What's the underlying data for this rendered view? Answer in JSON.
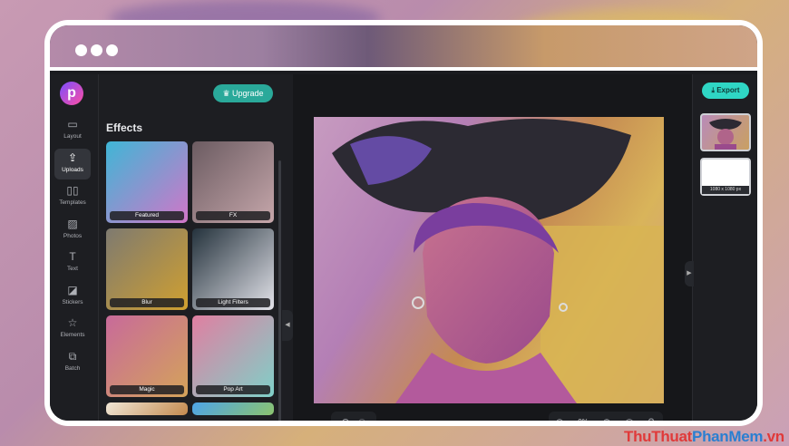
{
  "header": {
    "upgrade_label": "Upgrade",
    "export_label": "Export"
  },
  "rail": [
    {
      "label": "Layout",
      "icon": "layout-icon",
      "glyph": "▭"
    },
    {
      "label": "Uploads",
      "icon": "upload-icon",
      "glyph": "⇪"
    },
    {
      "label": "Templates",
      "icon": "book-icon",
      "glyph": "▯▯"
    },
    {
      "label": "Photos",
      "icon": "image-icon",
      "glyph": "▨"
    },
    {
      "label": "Text",
      "icon": "text-icon",
      "glyph": "T"
    },
    {
      "label": "Stickers",
      "icon": "sticker-icon",
      "glyph": "◪"
    },
    {
      "label": "Elements",
      "icon": "star-icon",
      "glyph": "☆"
    },
    {
      "label": "Batch",
      "icon": "batch-icon",
      "glyph": "⧉"
    }
  ],
  "active_rail": "Uploads",
  "panel": {
    "title": "Effects",
    "tiles": [
      {
        "label": "Featured",
        "bg": "linear-gradient(135deg,#3fb6d6,#d176c8)"
      },
      {
        "label": "FX",
        "bg": "linear-gradient(135deg,#6b5b61,#c6a7ab)"
      },
      {
        "label": "Blur",
        "bg": "linear-gradient(135deg,#7e7a70,#d0a030)"
      },
      {
        "label": "Light Filters",
        "bg": "linear-gradient(135deg,#24323c,#e3e3ea)"
      },
      {
        "label": "Magic",
        "bg": "linear-gradient(135deg,#c86a9a,#d4a35a)"
      },
      {
        "label": "Pop Art",
        "bg": "linear-gradient(135deg,#e07fa1,#7fd0c8)"
      },
      {
        "label": "",
        "bg": "linear-gradient(135deg,#f0e6d6,#c48a4e)"
      },
      {
        "label": "",
        "bg": "linear-gradient(135deg,#4ea4e8,#8bc36e)"
      }
    ]
  },
  "canvas": {
    "zoom": "0%"
  },
  "pages": {
    "size_label": "1080 x 1080 px"
  },
  "watermark": {
    "part1": "ThuThuat",
    "part2": "PhanMem",
    "part3": ".vn"
  }
}
